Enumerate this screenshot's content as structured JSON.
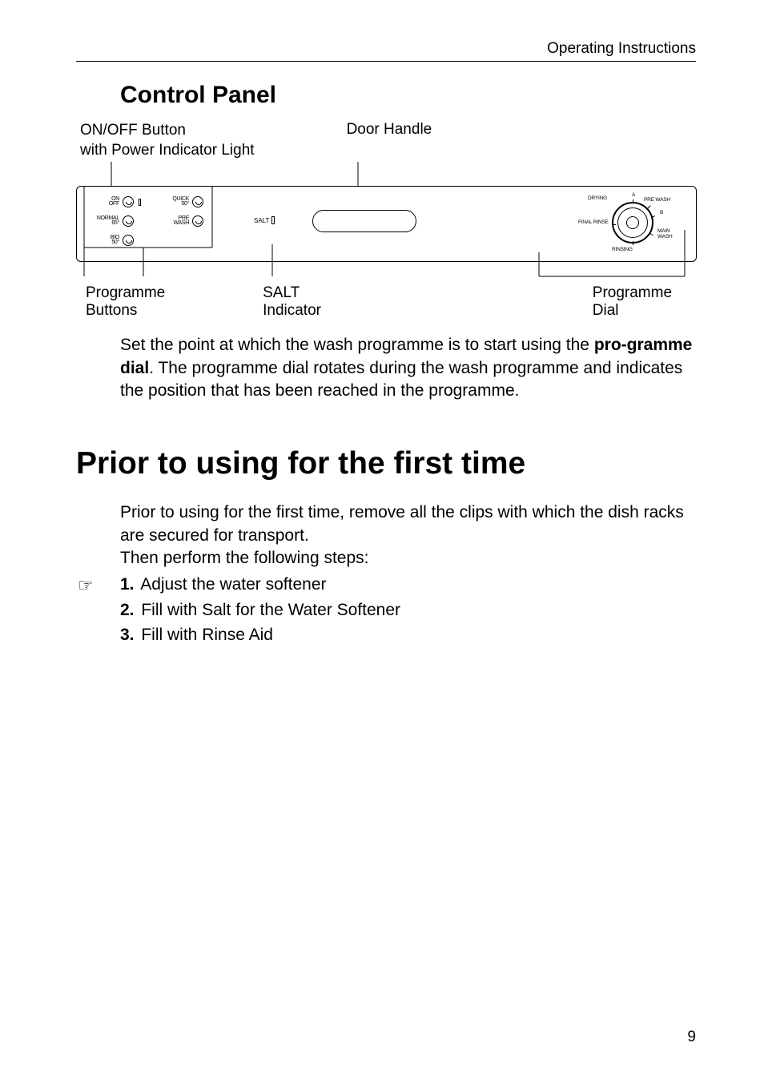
{
  "header": "Operating Instructions",
  "section_title": "Control Panel",
  "labels": {
    "onoff1": "ON/OFF Button",
    "onoff2": "with Power Indicator Light",
    "door": "Door Handle",
    "prog_btns": "Programme Buttons",
    "salt_ind": "SALT Indicator",
    "prog_dial": "Programme Dial"
  },
  "panel": {
    "onoff": "ON\nOFF",
    "normal": "NORMAL\n65°",
    "bio": "BIO\n50°",
    "quick": "QUICK\n50°",
    "prewash": "PRE\nWASH",
    "salt": "SALT"
  },
  "dial": {
    "drying": "DRYING",
    "a": "A",
    "prewash": "PRE WASH",
    "b": "B",
    "final_rinse": "FINAL RINSE",
    "main_wash": "MAIN WASH",
    "rinsing": "RINSING"
  },
  "paragraph1_a": "Set the point at which the wash programme is to start using the ",
  "paragraph1_b": "pro-gramme dial",
  "paragraph1_c": ". The programme dial rotates during the wash programme and indicates the position that has been reached in the programme.",
  "big_title": "Prior to using for the first time",
  "intro_a": "Prior to using for the first time, remove all the clips with which the dish racks are secured for transport.",
  "intro_b": "Then perform the following steps:",
  "steps": {
    "s1_num": "1.",
    "s1": "Adjust the water softener",
    "s2_num": "2.",
    "s2": "Fill with Salt for the Water Softener",
    "s3_num": "3.",
    "s3": "Fill with Rinse Aid"
  },
  "page_num": "9"
}
